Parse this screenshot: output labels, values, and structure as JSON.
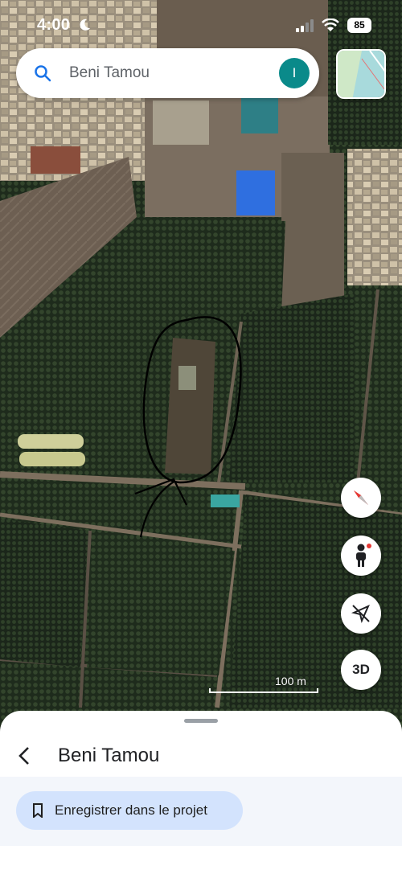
{
  "status_bar": {
    "time": "4:00",
    "battery": "85"
  },
  "search": {
    "value": "Beni Tamou",
    "avatar_letter": "I"
  },
  "map": {
    "view": "satellite",
    "scale_label": "100 m",
    "controls": [
      "compass-icon",
      "street-view-icon",
      "location-off-icon",
      "3D"
    ]
  },
  "controls": {
    "three_d_label": "3D"
  },
  "sheet": {
    "title": "Beni Tamou",
    "save_label": "Enregistrer dans le projet"
  }
}
